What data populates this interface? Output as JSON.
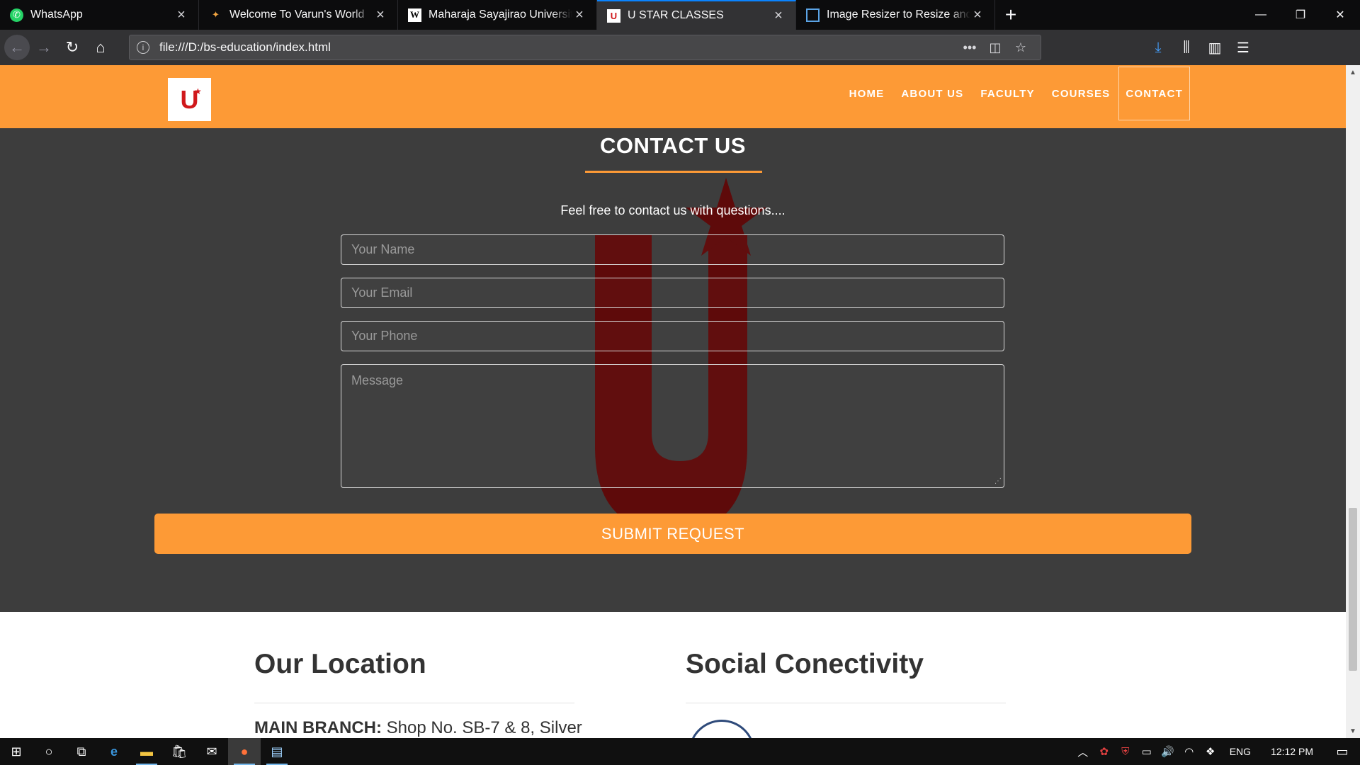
{
  "browser": {
    "tabs": [
      {
        "title": "WhatsApp",
        "icon": "whatsapp-icon",
        "active": false
      },
      {
        "title": "Welcome To Varun's World",
        "icon": "star-icon",
        "active": false
      },
      {
        "title": "Maharaja Sayajirao University of Baroda",
        "icon": "wikipedia-icon",
        "active": false
      },
      {
        "title": "U STAR CLASSES",
        "icon": "ustar-icon",
        "active": true
      },
      {
        "title": "Image Resizer to Resize and Crop",
        "icon": "image-resizer-icon",
        "active": false
      }
    ],
    "url": "file:///D:/bs-education/index.html",
    "accent_color": "#0a84ff"
  },
  "site": {
    "logo_letter": "U",
    "brand_color": "#fd9a36",
    "nav": [
      "HOME",
      "ABOUT US",
      "FACULTY",
      "COURSES",
      "CONTACT"
    ],
    "active_nav": "CONTACT"
  },
  "contact": {
    "heading": "CONTACT US",
    "subtitle": "Feel free to contact us with questions....",
    "name_placeholder": "Your Name",
    "email_placeholder": "Your Email",
    "phone_placeholder": "Your Phone",
    "message_placeholder": "Message",
    "submit_label": "SUBMIT REQUEST"
  },
  "location": {
    "heading": "Our Location",
    "branch_label": "MAIN BRANCH:",
    "branch_text": " Shop No. SB-7 & 8, Silver"
  },
  "social": {
    "heading": "Social Conectivity"
  },
  "taskbar": {
    "language": "ENG",
    "time": "12:12 PM"
  }
}
